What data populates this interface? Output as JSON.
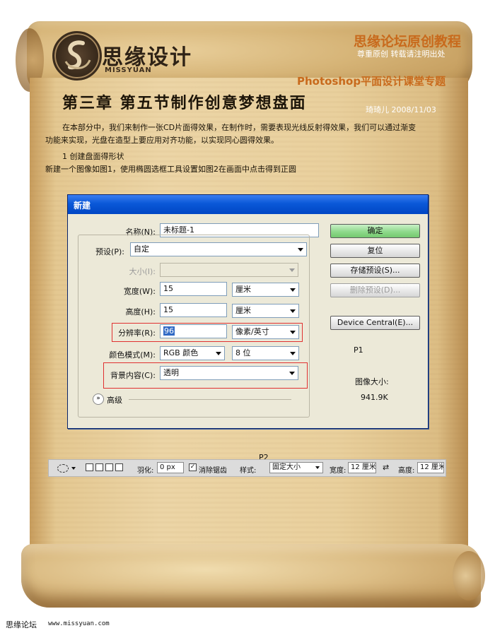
{
  "header": {
    "logo_text": "思缘设计",
    "logo_sub": "MISSYUAN",
    "banner_title": "思缘论坛原创教程",
    "banner_sub": "尊重原创  转载请注明出处",
    "topic": "Photoshop平面设计课堂专题"
  },
  "article": {
    "chapter": "第三章 第五节制作创意梦想盘面",
    "author": "琦琦儿 2008/11/03",
    "intro_line1": "在本部分中，我们来制作一张CD片面得效果，在制作时，需要表现光线反射得效果，我们可以通过渐变",
    "intro_line2": "功能来实现，光盘在造型上要应用对齐功能，以实现同心圆得效果。",
    "step1": "1 创建盘面得形状",
    "step1_desc": "新建一个图像如图1，使用椭圆选框工具设置如图2在画面中点击得到正圆"
  },
  "dialog": {
    "title": "新建",
    "name_label": "名称(N):",
    "name_value": "未标题-1",
    "preset_label": "预设(P):",
    "preset_value": "自定",
    "size_label": "大小(I):",
    "width_label": "宽度(W):",
    "width_value": "15",
    "width_unit": "厘米",
    "height_label": "高度(H):",
    "height_value": "15",
    "height_unit": "厘米",
    "resolution_label": "分辨率(R):",
    "resolution_value": "96",
    "resolution_unit": "像素/英寸",
    "color_mode_label": "颜色模式(M):",
    "color_mode_value": "RGB 颜色",
    "bit_depth_value": "8 位",
    "background_label": "背景内容(C):",
    "background_value": "透明",
    "advanced_label": "高级",
    "buttons": {
      "ok": "确定",
      "reset": "复位",
      "save_preset": "存储预设(S)...",
      "delete_preset": "删除预设(D)...",
      "device_central": "Device Central(E)..."
    },
    "figure_label": "P1",
    "image_size_label": "图像大小:",
    "image_size_value": "941.9K"
  },
  "toolbar": {
    "figure_label": "P2",
    "feather_label": "羽化:",
    "feather_value": "0 px",
    "antialias_label": "消除锯齿",
    "style_label": "样式:",
    "style_value": "固定大小",
    "width_label": "宽度:",
    "width_value": "12 厘米",
    "height_label": "高度:",
    "height_value": "12 厘米"
  },
  "footer": {
    "site": "思缘论坛",
    "url": "www.missyuan.com"
  },
  "colors": {
    "banner_orange": "#c86a1c",
    "titlebar_blue": "#0a58d8",
    "highlight_red": "#e03030",
    "ok_green": "#8fd98b"
  }
}
